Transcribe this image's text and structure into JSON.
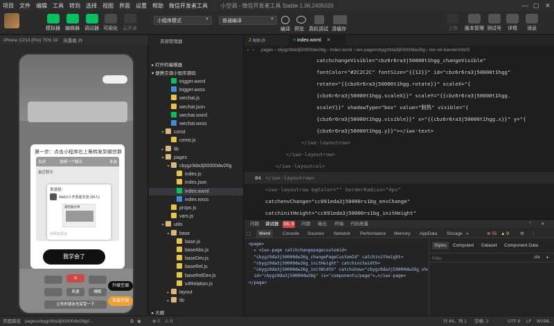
{
  "menubar": {
    "items": [
      "项目",
      "文件",
      "编辑",
      "工具",
      "转到",
      "选择",
      "视图",
      "界面",
      "设置",
      "帮助",
      "微信开发者工具"
    ],
    "window_title": "小空调 - 微信开发者工具 Stable 1.06.2405020"
  },
  "toolbar": {
    "simulator": "模拟器",
    "editor": "编辑器",
    "debugger": "调试器",
    "visual": "可视化",
    "cloud": "云开发",
    "mode_select": "小程序模式",
    "compile_select": "普通编译",
    "compile": "编译",
    "preview": "预览",
    "remote_debug": "真机调试",
    "clear_cache": "清缓存",
    "upload": "上传",
    "version": "版本管理",
    "test": "测试号",
    "details": "详情",
    "messages": "消息"
  },
  "simulator": {
    "device": "iPhone 12/13 (Pro) 75% 16",
    "hot_reload": "热重载 开",
    "tip_title": "第一步：点击小程序右上角转发到微信群",
    "tip_header_left": "关闭",
    "tip_header_right": "多选",
    "tip_header_mid": "选择一个聊天",
    "recent": "最近聊天",
    "send_to": "发送给：",
    "share_name": "Web3.0 开发者交流 (96人)",
    "share_card_title": "遥控器大师",
    "share_msg": "给朋友留言",
    "got_it": "我学会了",
    "btn_red": "①",
    "btn_mode": "风速",
    "btn_sleep": "睡眠",
    "btn_bottom": "让你的朋友也享受一下",
    "upgrade": "升级空调",
    "install": "安装空调"
  },
  "explorer": {
    "header": "资源管理器",
    "open_editors": "打开的编辑器",
    "project": "便携空调小程序源码",
    "outline": "大纲",
    "files": [
      {
        "name": "trigger.wxml",
        "icon": "wxml"
      },
      {
        "name": "trigger.wxss",
        "icon": "wxss"
      },
      {
        "name": "wechat.js",
        "icon": "js"
      },
      {
        "name": "wechat.json",
        "icon": "json"
      },
      {
        "name": "wechat.wxml",
        "icon": "wxml"
      },
      {
        "name": "wechat.wxss",
        "icon": "wxss"
      },
      {
        "name": "const",
        "icon": "folder"
      },
      {
        "name": "const.js",
        "icon": "js"
      },
      {
        "name": "lib",
        "icon": "folder"
      },
      {
        "name": "pages",
        "icon": "folder"
      },
      {
        "name": "cbygz9da3j50000dw26g",
        "icon": "folder"
      },
      {
        "name": "index.js",
        "icon": "js"
      },
      {
        "name": "index.json",
        "icon": "json"
      },
      {
        "name": "index.wxml",
        "icon": "wxml"
      },
      {
        "name": "index.wxss",
        "icon": "wxss"
      },
      {
        "name": "props.js",
        "icon": "js"
      },
      {
        "name": "vars.js",
        "icon": "js"
      },
      {
        "name": "utils",
        "icon": "folder"
      },
      {
        "name": "base",
        "icon": "folder"
      },
      {
        "name": "base.js",
        "icon": "js"
      },
      {
        "name": "baseAbs.js",
        "icon": "js"
      },
      {
        "name": "baseDev.js",
        "icon": "js"
      },
      {
        "name": "baseRel.js",
        "icon": "js"
      },
      {
        "name": "baseRelDev.js",
        "icon": "js"
      },
      {
        "name": "v4Relation.js",
        "icon": "js"
      },
      {
        "name": "layout",
        "icon": "folder"
      },
      {
        "name": "lib",
        "icon": "folder"
      }
    ]
  },
  "editor": {
    "tabs": [
      "app.js",
      "index.wxml"
    ],
    "breadcrumb": "pages › cbygz9da3j50000dw26g › index.wxml › iwx-page#cbygz9da3j50000dw26g › iwx-rel-banner#cbz5",
    "lines": [
      {
        "n": "",
        "t": "catchchangeVisible=\"cbz6r6ra3j50000t1hgg_changeVisible\""
      },
      {
        "n": "",
        "t": "fontColor=\"#2C2C2C\" fontSize=\"{{12}}\" id=\"cbz6r6ra3j50000t1hgg\""
      },
      {
        "n": "",
        "t": "rotate=\"{{cbz6r6ra3j50000t1hgg.rotate}}\" scaleX=\"{"
      },
      {
        "n": "",
        "t": "{cbz6r6ra3j50000t1hgg.scaleX}}\" scaleY=\"{{cbz6r6ra3j50000t1hgg."
      },
      {
        "n": "",
        "t": "scaleY}}\" shadowType=\"box\" value=\"制热\" visible=\"{"
      },
      {
        "n": "",
        "t": "{cbz6r6ra3j50000t1hgg.visible}}\" x=\"{{cbz6r6ra3j50000t1hgg.x}}\" y=\"{"
      },
      {
        "n": "",
        "t": "{cbz6r6ra3j50000t1hgg.y}}\"></iwx-text>"
      },
      {
        "n": "",
        "t": "</iwx-layoutrow>"
      },
      {
        "n": "",
        "t": "</iwx-layoutrow>"
      },
      {
        "n": "",
        "t": "</iwx-layoutcol>"
      },
      {
        "n": "84",
        "t": "</iwx-layoutrow>"
      },
      {
        "n": "",
        "t": "<iwx-layoutrow bgColor=\"\" borderRadius=\"4px\""
      },
      {
        "n": "",
        "t": "catchenvChange=\"cc091eda3j50000rs1bg_envChange\""
      },
      {
        "n": "",
        "t": "catchinitHeight=\"cc091eda3j50000rs1bg_initHeight\""
      }
    ]
  },
  "devtools": {
    "top_tabs": [
      "问题",
      "调试器",
      "55, 9",
      "问题",
      "输出",
      "终端",
      "代码质量"
    ],
    "panels": [
      "Wxml",
      "Console",
      "Sources",
      "Network",
      "Performance",
      "Memory",
      "AppData",
      "Storage"
    ],
    "errors": "55",
    "warnings": "9",
    "dom": "<page>\n  ▸ <iwx-page catchchangepagecustomid=\n  \"cbygz9da3j50000dw26g_changePageCustomId\" catchinitheight=\n  \"cbygz9da3j50000dw26g_initHeight\" catchinitwidth=\n  \"cbygz9da3j50000dw26g_initWidth\" catchshow=\"cbygz9da3j50000dw26g_show\"\n  id=\"cbygz9da3j50000dw26g\" is=\"components/page\">…</iwx-page>\n</page>",
    "style_tabs": [
      "Styles",
      "Computed",
      "Dataset",
      "Component Data"
    ],
    "filter": "Filter",
    "cls": ".cls"
  },
  "statusbar": {
    "path_label": "页面路径",
    "path": "pages/cbygz9da3j50000dw26g/i...",
    "errors": "0",
    "warnings": "0",
    "position": "行 84，列 1",
    "spaces": "空格: 2",
    "encoding": "UTF-8",
    "eol": "LF",
    "lang": "WXML"
  },
  "colors": {
    "accent_green": "#07c160",
    "string": "#ce9178",
    "tag": "#569cd6"
  }
}
